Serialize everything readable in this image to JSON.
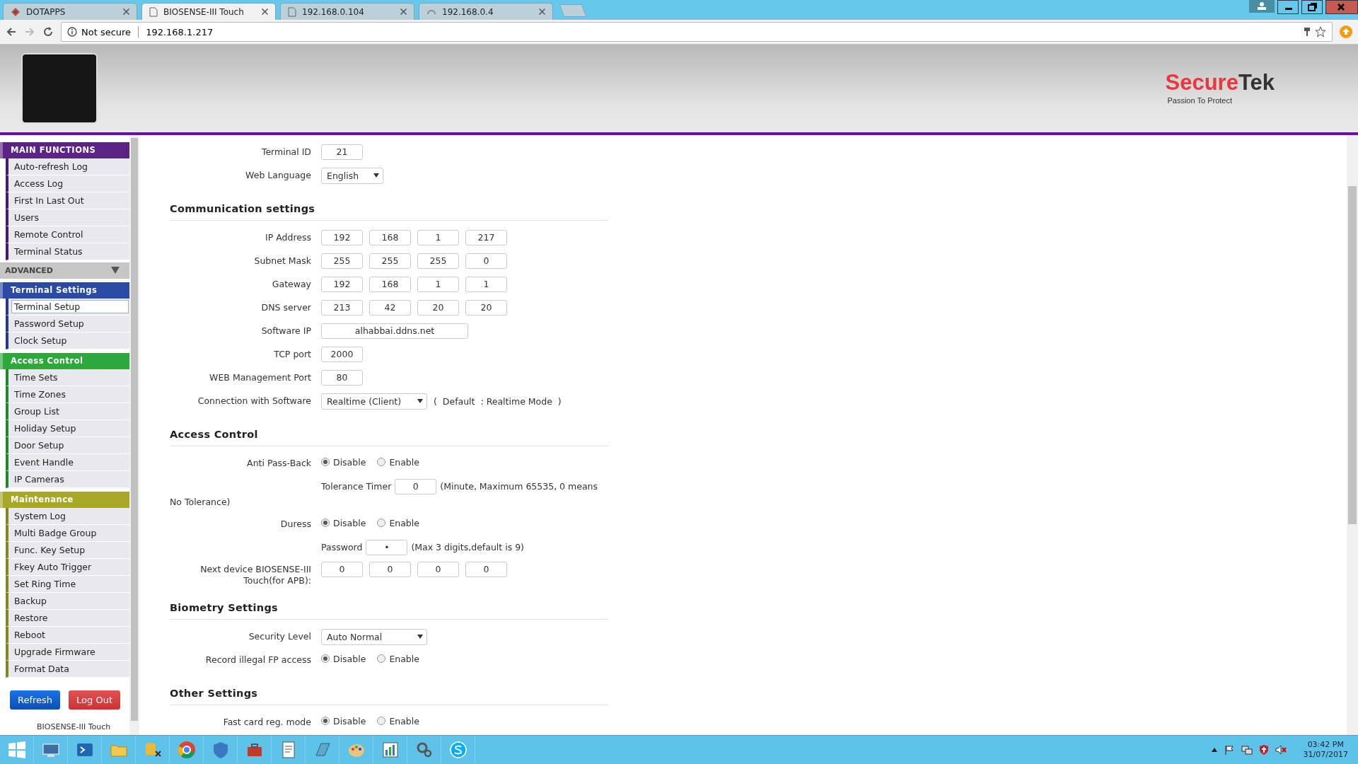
{
  "browser": {
    "tabs": [
      {
        "title": "DOTAPPS",
        "kind": "site",
        "selected": false
      },
      {
        "title": "BIOSENSE-III Touch",
        "kind": "page",
        "selected": true
      },
      {
        "title": "192.168.0.104",
        "kind": "page",
        "selected": false
      },
      {
        "title": "192.168.0.4",
        "kind": "loading",
        "selected": false
      }
    ],
    "security": "Not secure",
    "url": "192.168.1.217"
  },
  "header": {
    "brand_red": "Secure",
    "brand_dark": "Tek",
    "tagline": "Passion To Protect"
  },
  "sidebar": {
    "groups": [
      {
        "title": "MAIN FUNCTIONS",
        "kind": "group",
        "color": "#5b2384",
        "items": [
          {
            "label": "Auto-refresh Log",
            "selected": false
          },
          {
            "label": "Access Log",
            "selected": false
          },
          {
            "label": "First In Last Out",
            "selected": false
          },
          {
            "label": "Users",
            "selected": false
          },
          {
            "label": "Remote Control",
            "selected": false
          },
          {
            "label": "Terminal Status",
            "selected": false
          }
        ]
      },
      {
        "title": "ADVANCED",
        "kind": "collapsible",
        "expanded": true
      },
      {
        "title": "Terminal Settings",
        "kind": "group",
        "color": "#2b4aa6",
        "items": [
          {
            "label": "Terminal Setup",
            "selected": true
          },
          {
            "label": "Password Setup",
            "selected": false
          },
          {
            "label": "Clock Setup",
            "selected": false
          }
        ]
      },
      {
        "title": "Access Control",
        "kind": "group",
        "color": "#2ca83c",
        "items": [
          {
            "label": "Time Sets",
            "selected": false
          },
          {
            "label": "Time Zones",
            "selected": false
          },
          {
            "label": "Group List",
            "selected": false
          },
          {
            "label": "Holiday Setup",
            "selected": false
          },
          {
            "label": "Door Setup",
            "selected": false
          },
          {
            "label": "Event Handle",
            "selected": false
          },
          {
            "label": "IP Cameras",
            "selected": false
          }
        ]
      },
      {
        "title": "Maintenance",
        "kind": "group",
        "color": "#a8a826",
        "items": [
          {
            "label": "System Log",
            "selected": false
          },
          {
            "label": "Multi Badge Group",
            "selected": false
          },
          {
            "label": "Func. Key Setup",
            "selected": false
          },
          {
            "label": "Fkey Auto Trigger",
            "selected": false
          },
          {
            "label": "Set Ring Time",
            "selected": false
          },
          {
            "label": "Backup",
            "selected": false
          },
          {
            "label": "Restore",
            "selected": false
          },
          {
            "label": "Reboot",
            "selected": false
          },
          {
            "label": "Upgrade Firmware",
            "selected": false
          },
          {
            "label": "Format Data",
            "selected": false
          }
        ]
      }
    ],
    "buttons": [
      {
        "label": "Refresh",
        "kind": "primary"
      },
      {
        "label": "Log Out",
        "kind": "danger"
      }
    ],
    "footer": "BIOSENSE-III Touch"
  },
  "form": {
    "sections": [
      {
        "rows": [
          {
            "kind": "inputs",
            "label": "Terminal ID",
            "values": [
              "21"
            ]
          },
          {
            "kind": "select",
            "label": "Web Language",
            "value": "English"
          }
        ]
      },
      {
        "heading": "Communication settings",
        "rows": [
          {
            "kind": "inputs",
            "label": "IP Address",
            "values": [
              "192",
              "168",
              "1",
              "217"
            ]
          },
          {
            "kind": "inputs",
            "label": "Subnet Mask",
            "values": [
              "255",
              "255",
              "255",
              "0"
            ]
          },
          {
            "kind": "inputs",
            "label": "Gateway",
            "values": [
              "192",
              "168",
              "1",
              "1"
            ]
          },
          {
            "kind": "inputs",
            "label": "DNS server",
            "values": [
              "213",
              "42",
              "20",
              "20"
            ]
          },
          {
            "kind": "wide_input",
            "label": "Software IP",
            "value": "alhabbai.ddns.net"
          },
          {
            "kind": "inputs",
            "label": "TCP port",
            "values": [
              "2000"
            ]
          },
          {
            "kind": "inputs",
            "label": "WEB Management Port",
            "values": [
              "80"
            ]
          },
          {
            "kind": "select",
            "label": "Connection with Software",
            "value": "Realtime (Client)",
            "note": "(  Default  : Realtime Mode  )"
          }
        ]
      },
      {
        "heading": "Access Control",
        "rows": [
          {
            "kind": "radio",
            "label": "Anti Pass-Back",
            "options": [
              {
                "label": "Disable",
                "selected": true
              },
              {
                "label": "Enable",
                "selected": false
              }
            ]
          },
          {
            "kind": "inline_input",
            "prefix": "Tolerance Timer",
            "value": "0",
            "note": "(Minute, Maximum 65535, 0 means",
            "note_continued": "No Tolerance)"
          },
          {
            "kind": "radio",
            "label": "Duress",
            "options": [
              {
                "label": "Disable",
                "selected": true
              },
              {
                "label": "Enable",
                "selected": false
              }
            ]
          },
          {
            "kind": "inline_input",
            "prefix": "Password",
            "value": "•",
            "note": "(Max 3 digits,default is 9)"
          },
          {
            "kind": "inputs",
            "label": "Next device BIOSENSE-III Touch(for APB):",
            "values": [
              "0",
              "0",
              "0",
              "0"
            ]
          }
        ]
      },
      {
        "heading": "Biometry Settings",
        "rows": [
          {
            "kind": "select",
            "label": "Security Level",
            "value": "Auto Normal"
          },
          {
            "kind": "radio",
            "label": "Record illegal FP access",
            "options": [
              {
                "label": "Disable",
                "selected": true
              },
              {
                "label": "Enable",
                "selected": false
              }
            ]
          }
        ]
      },
      {
        "heading": "Other Settings",
        "rows": [
          {
            "kind": "radio",
            "label": "Fast card reg. mode",
            "options": [
              {
                "label": "Disable",
                "selected": true
              },
              {
                "label": "Enable",
                "selected": false
              }
            ]
          }
        ]
      }
    ]
  },
  "taskbar": {
    "time": "03:42 PM",
    "date": "31/07/2017"
  }
}
